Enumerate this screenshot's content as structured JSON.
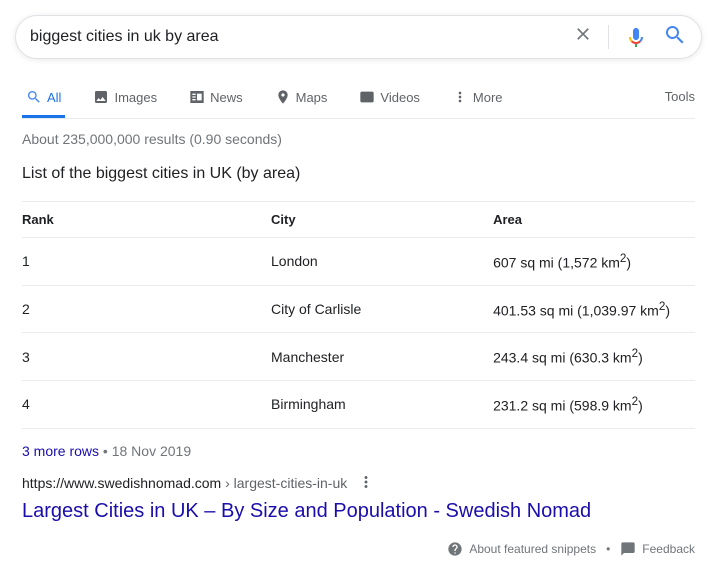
{
  "search": {
    "query": "biggest cities in uk by area"
  },
  "tabs": {
    "all": "All",
    "images": "Images",
    "news": "News",
    "maps": "Maps",
    "videos": "Videos",
    "more": "More",
    "tools": "Tools"
  },
  "stats": "About 235,000,000 results (0.90 seconds)",
  "snippet": {
    "title": "List of the biggest cities in UK (by area)",
    "headers": {
      "rank": "Rank",
      "city": "City",
      "area": "Area"
    },
    "rows": [
      {
        "rank": "1",
        "city": "London",
        "area_pre": "607 sq mi (1,572 km",
        "area_post": ")"
      },
      {
        "rank": "2",
        "city": "City of Carlisle",
        "area_pre": "401.53 sq mi (1,039.97 km",
        "area_post": ")"
      },
      {
        "rank": "3",
        "city": "Manchester",
        "area_pre": "243.4 sq mi (630.3 km",
        "area_post": ")"
      },
      {
        "rank": "4",
        "city": "Birmingham",
        "area_pre": "231.2 sq mi (598.9 km",
        "area_post": ")"
      }
    ],
    "more_rows": "3 more rows",
    "date": "18 Nov 2019"
  },
  "result": {
    "cite_host": "https://www.swedishnomad.com",
    "cite_path": " › largest-cities-in-uk",
    "title": "Largest Cities in UK – By Size and Population - Swedish Nomad"
  },
  "footer": {
    "about": "About featured snippets",
    "feedback": "Feedback"
  },
  "chart_data": {
    "type": "table",
    "title": "List of the biggest cities in UK (by area)",
    "columns": [
      "Rank",
      "City",
      "Area"
    ],
    "rows": [
      [
        1,
        "London",
        "607 sq mi (1,572 km²)"
      ],
      [
        2,
        "City of Carlisle",
        "401.53 sq mi (1,039.97 km²)"
      ],
      [
        3,
        "Manchester",
        "243.4 sq mi (630.3 km²)"
      ],
      [
        4,
        "Birmingham",
        "231.2 sq mi (598.9 km²)"
      ]
    ]
  }
}
